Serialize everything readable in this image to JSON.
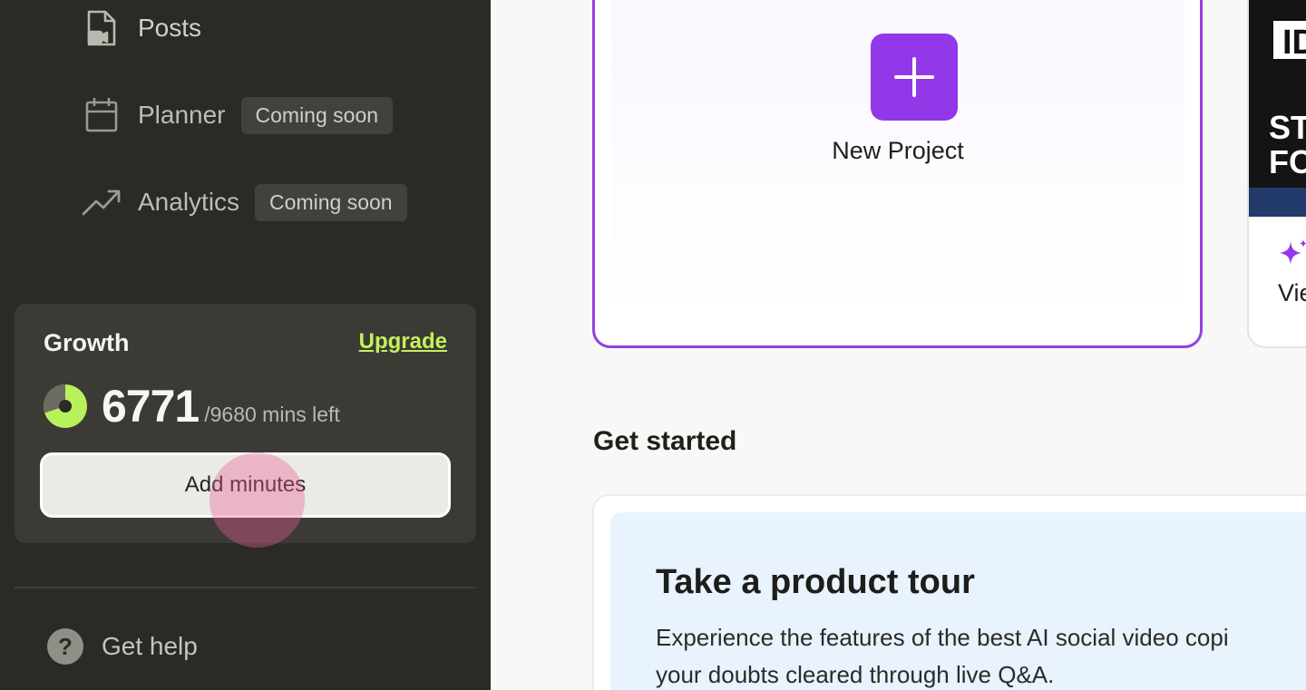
{
  "sidebar": {
    "nav": [
      {
        "label": "Posts",
        "icon": "video-file-icon"
      },
      {
        "label": "Planner",
        "icon": "calendar-icon",
        "badge": "Coming soon"
      },
      {
        "label": "Analytics",
        "icon": "trending-up-icon",
        "badge": "Coming soon"
      }
    ],
    "plan": {
      "name": "Growth",
      "upgrade_label": "Upgrade",
      "minutes_left": "6771",
      "minutes_suffix": "/9680 mins left",
      "used_fraction": 0.3,
      "add_button_label": "Add minutes"
    },
    "help_label": "Get help"
  },
  "main": {
    "new_project_label": "New Project",
    "thumbnail": {
      "overlay_text_top": "ID",
      "overlay_text_body": "STICK\nFOOT",
      "label": "Vie"
    },
    "get_started_title": "Get started",
    "tour": {
      "title": "Take a product tour",
      "description_line1": "Experience the features of the best AI social video copi",
      "description_line2": "your doubts cleared through live Q&A."
    }
  },
  "colors": {
    "sidebar_bg": "#2a2a26",
    "accent_purple": "#9238e8",
    "accent_lime": "#c5f05a",
    "tour_bg": "#e8f3fd"
  }
}
